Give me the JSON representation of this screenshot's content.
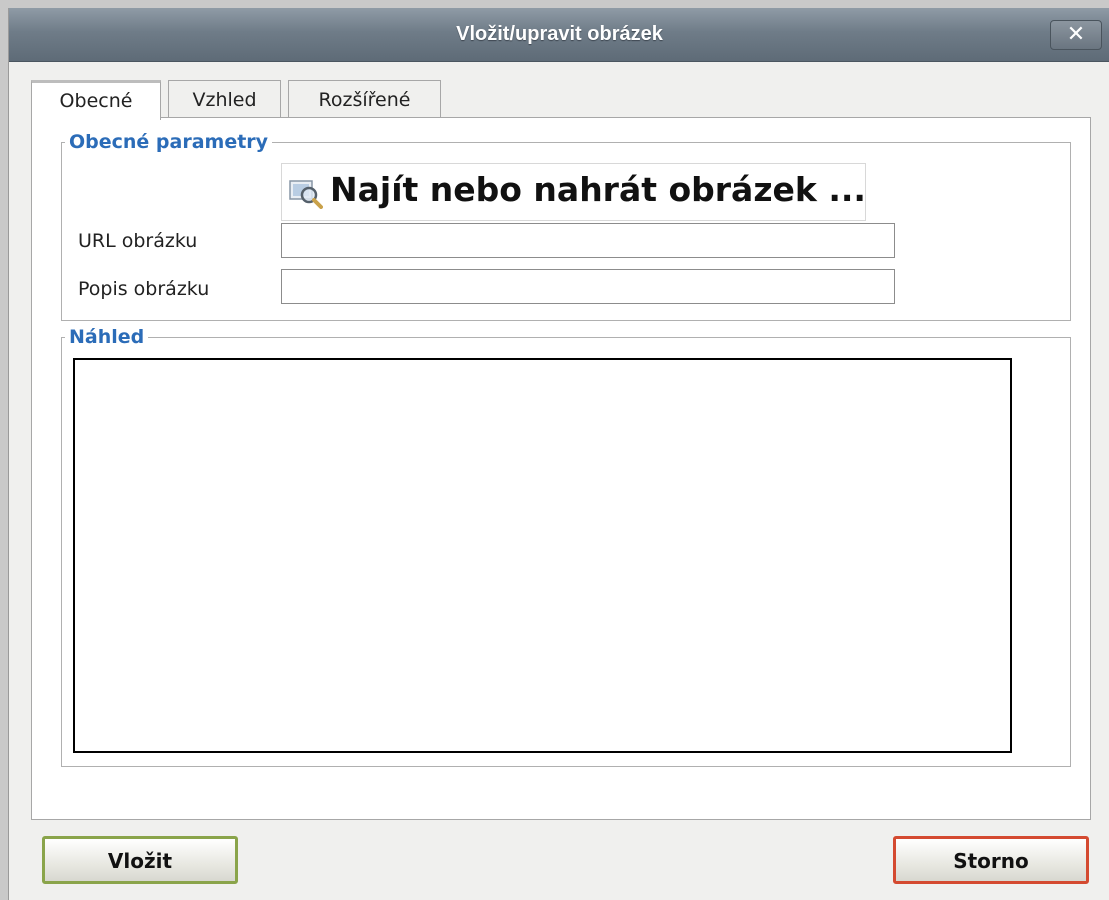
{
  "dialog": {
    "title": "Vložit/upravit obrázek",
    "close_label": "✕"
  },
  "tabs": [
    {
      "label": "Obecné",
      "active": true
    },
    {
      "label": "Vzhled",
      "active": false
    },
    {
      "label": "Rozšířené",
      "active": false
    }
  ],
  "general": {
    "legend": "Obecné parametry",
    "browse_label": "Najít nebo nahrát obrázek ...",
    "browse_icon": "magnifier-image-icon",
    "url_label": "URL obrázku",
    "url_value": "",
    "alt_label": "Popis obrázku",
    "alt_value": ""
  },
  "preview": {
    "legend": "Náhled"
  },
  "actions": {
    "insert_label": "Vložit",
    "cancel_label": "Storno"
  },
  "colors": {
    "legend_text": "#2b6cb8",
    "insert_border": "#8aa44a",
    "cancel_border": "#d44a30",
    "titlebar": "#6f7c88"
  }
}
